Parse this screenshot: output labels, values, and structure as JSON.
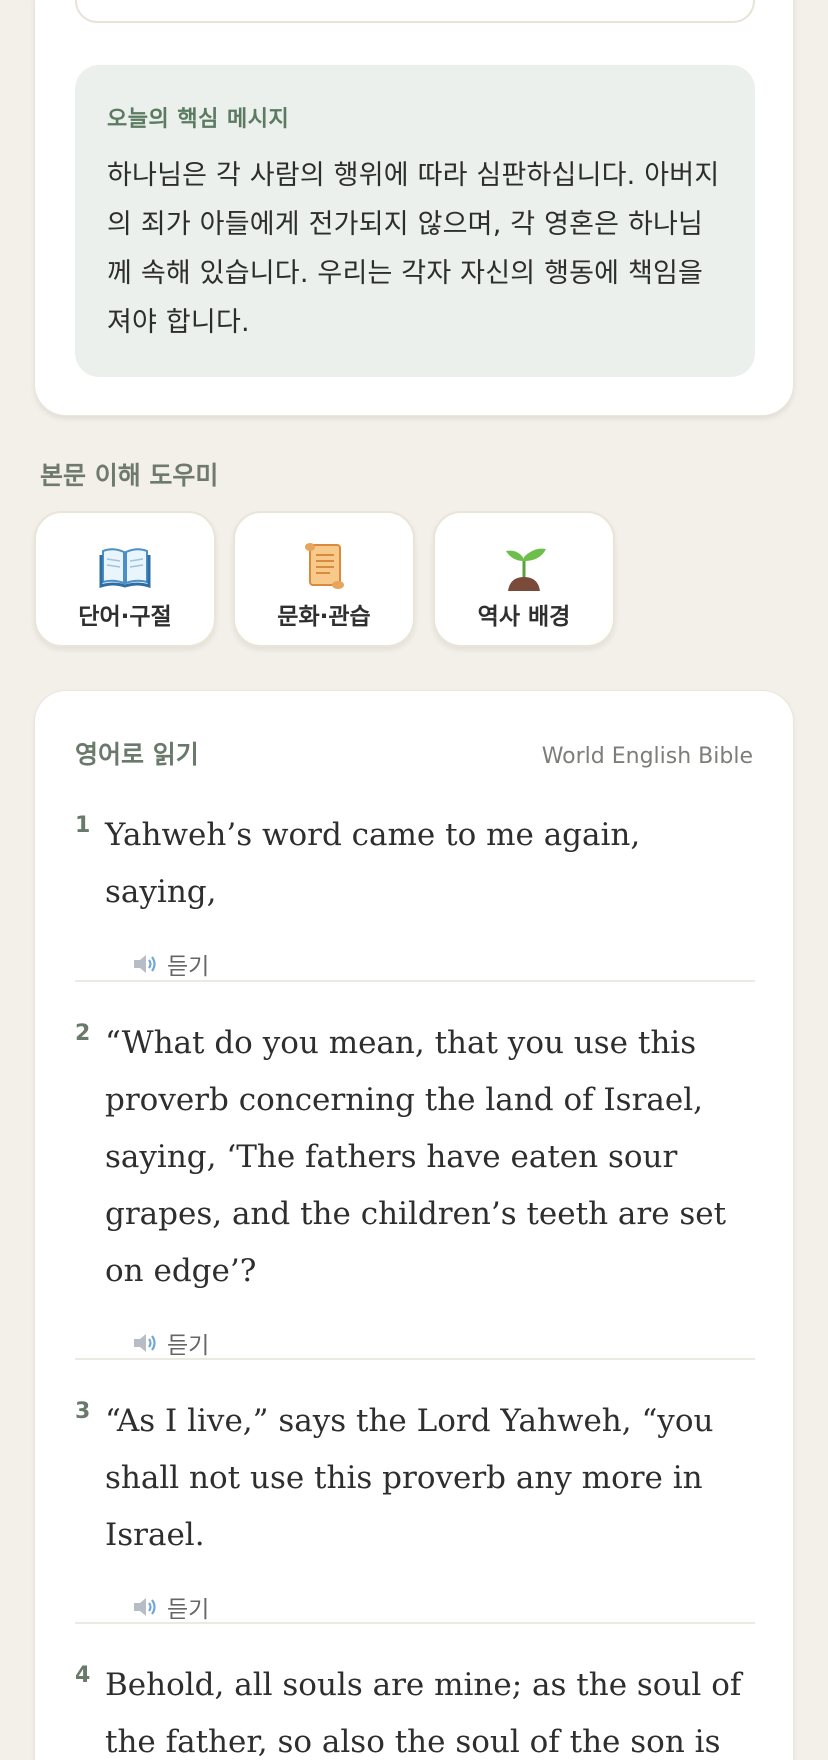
{
  "message": {
    "title": "오늘의 핵심 메시지",
    "text": "하나님은 각 사람의 행위에 따라 심판하십니다. 아버지의 죄가 아들에게 전가되지 않으며, 각 영혼은 하나님께 속해 있습니다. 우리는 각자 자신의 행동에 책임을 져야 합니다."
  },
  "helper": {
    "title": "본문 이해 도우미",
    "cards": [
      {
        "label": "단어·구절",
        "icon": "open-book-icon"
      },
      {
        "label": "문화·관습",
        "icon": "scroll-icon"
      },
      {
        "label": "역사 배경",
        "icon": "seedling-icon"
      }
    ]
  },
  "reading": {
    "title": "영어로 읽기",
    "source": "World English Bible",
    "listen_label": "듣기",
    "verses": [
      {
        "num": "1",
        "text": "Yahweh’s word came to me again, saying,"
      },
      {
        "num": "2",
        "text": "“What do you mean, that you use this proverb concerning the land of Israel, saying, ‘The fathers have eaten sour grapes, and the children’s teeth are set on edge’?"
      },
      {
        "num": "3",
        "text": "“As I live,” says the Lord Yahweh, “you shall not use this proverb any more in Israel."
      },
      {
        "num": "4",
        "text": "Behold, all souls are mine; as the soul of the father, so also the soul of the son is mine."
      }
    ]
  },
  "colors": {
    "background": "#f3f0ea",
    "accent_green": "#5b7a62",
    "message_bg": "#ecf0ec"
  }
}
